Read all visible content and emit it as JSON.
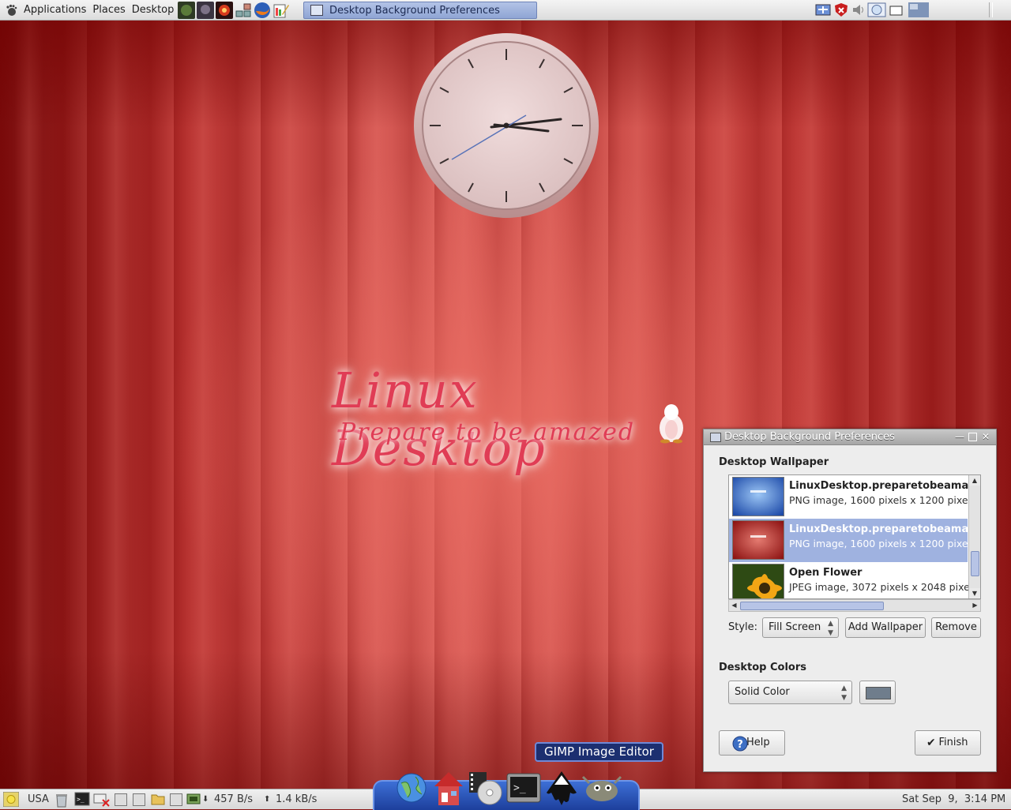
{
  "top_panel": {
    "menus": [
      "Applications",
      "Places",
      "Desktop"
    ],
    "launcher_icons": [
      "game-icon-1",
      "game-icon-2",
      "game-icon-3",
      "network-icon",
      "firefox-icon",
      "editor-icon"
    ],
    "task_button": "Desktop Background Preferences",
    "tray_icons": [
      "applet-icon",
      "shield-icon",
      "volume-icon",
      "network-monitor-icon",
      "window-icon",
      "workspace-icon"
    ]
  },
  "wallpaper_text": {
    "title": "Linux Desktop",
    "subtitle": "Prepare to be amazed"
  },
  "dialog": {
    "title": "Desktop Background Preferences",
    "wallpaper_section": "Desktop Wallpaper",
    "wallpapers": [
      {
        "name": "LinuxDesktop.preparetobeama",
        "meta": "PNG image, 1600 pixels x 1200 pixe",
        "selected": false,
        "thumb": "blue"
      },
      {
        "name": "LinuxDesktop.preparetobeama",
        "meta": "PNG image, 1600 pixels x 1200 pixe",
        "selected": true,
        "thumb": "red"
      },
      {
        "name": "Open Flower",
        "meta": "JPEG image, 3072 pixels x 2048 pixe",
        "selected": false,
        "thumb": "flower"
      }
    ],
    "style_label": "Style:",
    "style_value": "Fill Screen",
    "add_wallpaper": "Add Wallpaper",
    "remove": "Remove",
    "colors_section": "Desktop Colors",
    "color_mode": "Solid Color",
    "color_value": "#6f7d8c",
    "help": "Help",
    "finish": "Finish"
  },
  "tooltip": "GIMP Image Editor",
  "dock_icons": [
    "globe-icon",
    "home-icon",
    "media-player-icon",
    "terminal-icon",
    "inkscape-icon",
    "gimp-icon"
  ],
  "bottom_panel": {
    "keyboard_layout": "USA",
    "download_rate": "457 B/s",
    "upload_rate": "1.4 kB/s",
    "clock": "Sat Sep  9,  3:14 PM"
  },
  "colors": {
    "selection": "#9fb2e0",
    "accent_blue": "#1c2f70"
  }
}
